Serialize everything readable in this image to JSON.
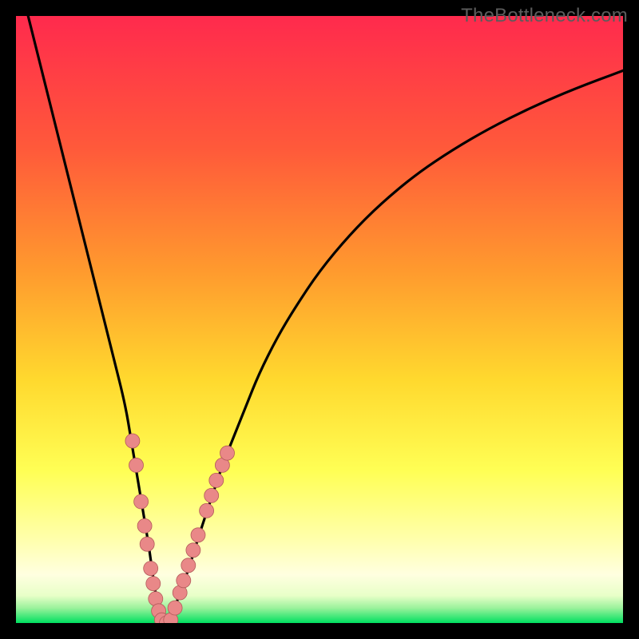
{
  "watermark": "TheBottleneck.com",
  "colors": {
    "bg": "#000000",
    "grad_top": "#ff2a4d",
    "grad_mid1": "#ff7a2e",
    "grad_mid2": "#ffd92e",
    "grad_mid3": "#ffff66",
    "grad_pale": "#ffffcc",
    "grad_bottom": "#00e060",
    "curve": "#000000",
    "marker_fill": "#e98888",
    "marker_stroke": "#b45a5a"
  },
  "chart_data": {
    "type": "line",
    "title": "",
    "xlabel": "",
    "ylabel": "",
    "xlim": [
      0,
      100
    ],
    "ylim": [
      0,
      100
    ],
    "series": [
      {
        "name": "bottleneck-curve",
        "x": [
          2,
          4,
          6,
          8,
          10,
          12,
          14,
          16,
          18,
          19,
          20,
          21,
          22,
          22.8,
          23.5,
          24.2,
          25,
          26,
          27,
          28.5,
          30,
          32,
          34,
          36,
          38,
          40,
          43,
          46,
          50,
          55,
          60,
          66,
          72,
          78,
          85,
          92,
          100
        ],
        "y": [
          100,
          92,
          84,
          76,
          68,
          60,
          52,
          44,
          36,
          30,
          24,
          18,
          12,
          6,
          2,
          0,
          0,
          2,
          5,
          9,
          14,
          20,
          26,
          31,
          36,
          41,
          47,
          52,
          58,
          64,
          69,
          74,
          78,
          81.5,
          85,
          88,
          91
        ]
      }
    ],
    "markers": [
      {
        "x": 19.2,
        "y": 30
      },
      {
        "x": 19.8,
        "y": 26
      },
      {
        "x": 20.6,
        "y": 20
      },
      {
        "x": 21.2,
        "y": 16
      },
      {
        "x": 21.6,
        "y": 13
      },
      {
        "x": 22.2,
        "y": 9
      },
      {
        "x": 22.6,
        "y": 6.5
      },
      {
        "x": 23.0,
        "y": 4
      },
      {
        "x": 23.5,
        "y": 2
      },
      {
        "x": 24.0,
        "y": 0.5
      },
      {
        "x": 24.8,
        "y": 0
      },
      {
        "x": 25.5,
        "y": 0.5
      },
      {
        "x": 26.2,
        "y": 2.5
      },
      {
        "x": 27.0,
        "y": 5
      },
      {
        "x": 27.6,
        "y": 7
      },
      {
        "x": 28.4,
        "y": 9.5
      },
      {
        "x": 29.2,
        "y": 12
      },
      {
        "x": 30.0,
        "y": 14.5
      },
      {
        "x": 31.4,
        "y": 18.5
      },
      {
        "x": 32.2,
        "y": 21
      },
      {
        "x": 33.0,
        "y": 23.5
      },
      {
        "x": 34.0,
        "y": 26
      },
      {
        "x": 34.8,
        "y": 28
      }
    ]
  }
}
